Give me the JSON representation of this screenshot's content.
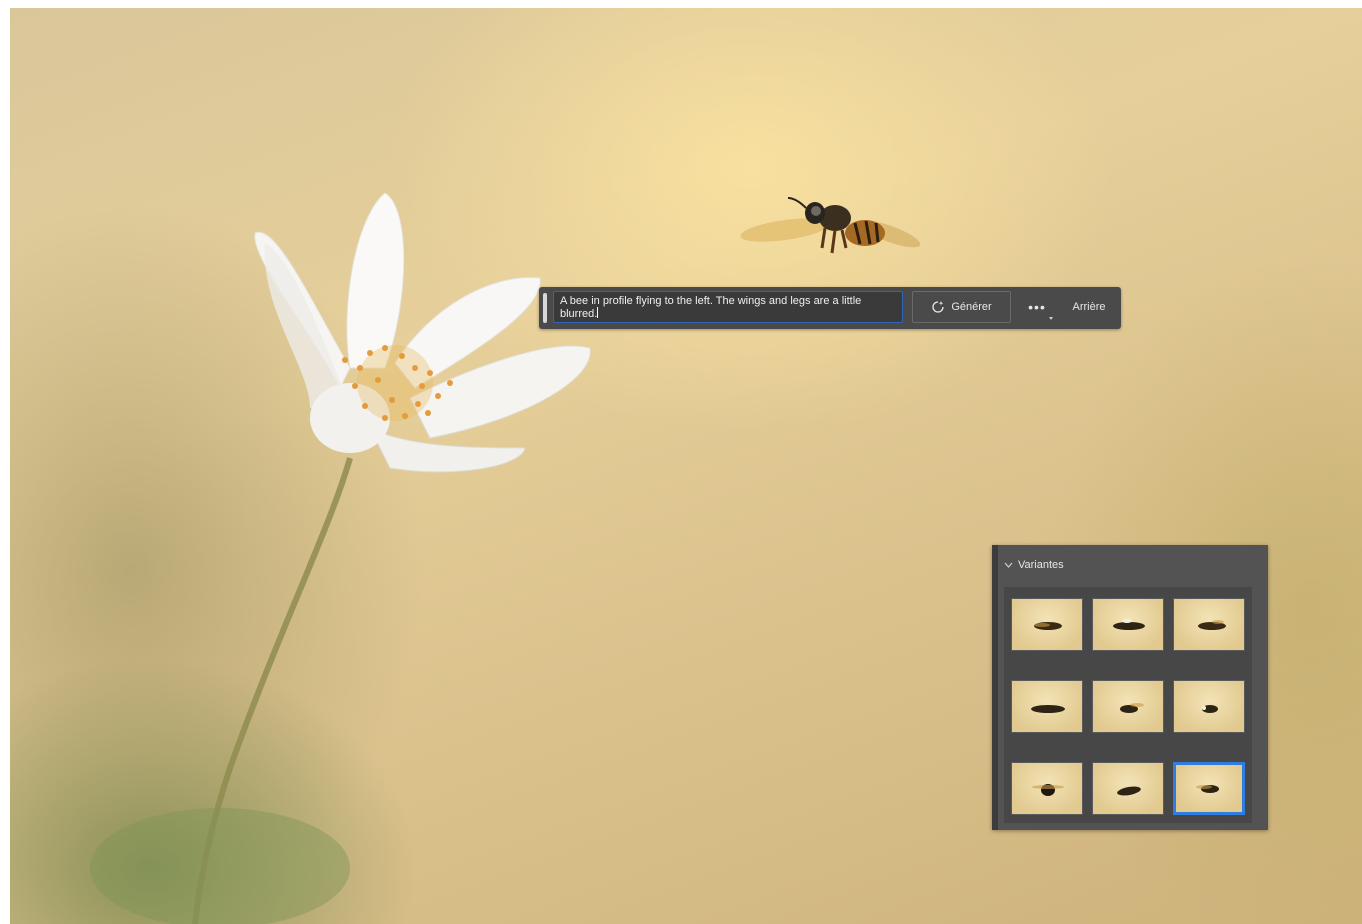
{
  "prompt": {
    "text": "A bee in profile flying to the left. The wings and legs are a little blurred."
  },
  "toolbar": {
    "generate_label": "Générer",
    "more_label": "•••",
    "back_label": "Arrière"
  },
  "variants_panel": {
    "title": "Variantes",
    "selected_index": 9,
    "thumbnails": [
      1,
      2,
      3,
      4,
      5,
      6,
      7,
      8,
      9
    ]
  },
  "icons": {
    "generate": "generate-sparkle-icon",
    "collapse": "chevron-down-icon",
    "more": "more-options-icon"
  },
  "colors": {
    "accent": "#2f7de1",
    "panel": "#535353",
    "bar": "#4a4a4a"
  }
}
